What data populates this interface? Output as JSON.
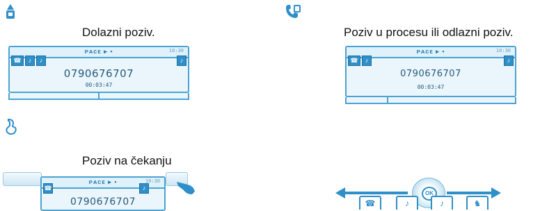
{
  "incoming": {
    "caption": "Dolazni poziv.",
    "screen_title": "ᴘᴀᴄᴇ ▸ ▪",
    "time": "10:30",
    "number": "0790676707",
    "duration": "00:03:47"
  },
  "outgoing": {
    "caption": "Poziv u procesu ili odlazni poziv.",
    "screen_title": "ᴘᴀᴄᴇ ▸ ▪",
    "time": "10:30",
    "number": "0790676707",
    "duration": "00:03:47"
  },
  "hold": {
    "caption": "Poziv na čekanju",
    "screen_title": "ᴘᴀᴄᴇ ▸ ▪",
    "time": "10:30",
    "number": "0790676707"
  },
  "nav": {
    "ok_label": "OK"
  },
  "icons": {
    "incoming": "incoming-call-icon",
    "outgoing": "call-in-progress-icon",
    "hold": "call-on-hold-icon",
    "accent": "#2f8fc8"
  }
}
